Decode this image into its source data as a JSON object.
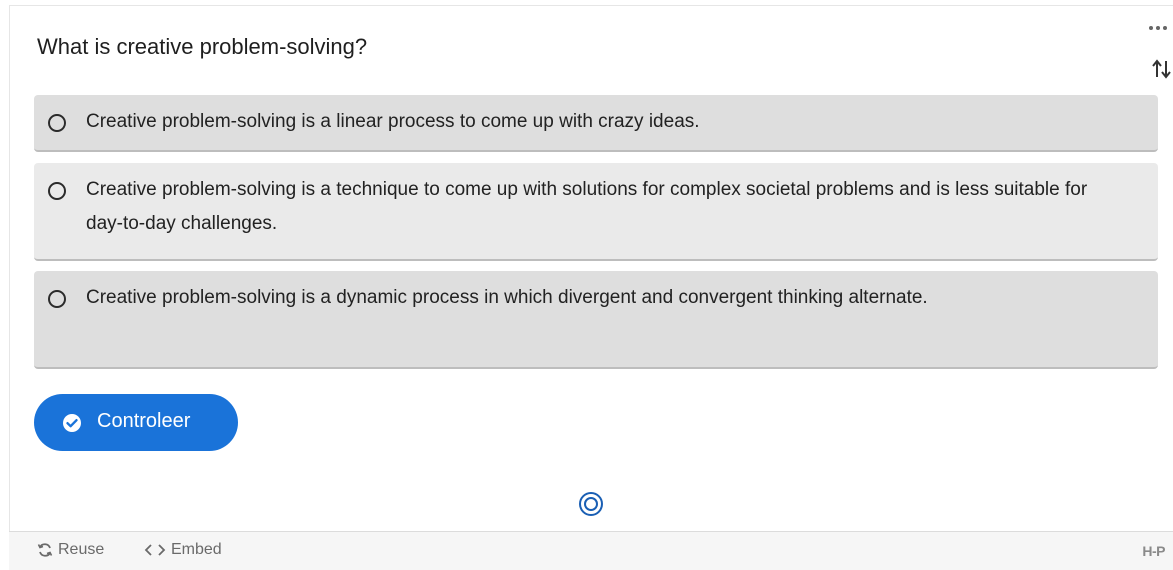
{
  "question": {
    "text": "What is creative problem-solving?"
  },
  "icons": {
    "more": "more-horizontal-icon",
    "sort": "sort-arrows-icon",
    "check": "check-circle-icon",
    "logo_mark": "h5p-circle-icon",
    "reuse": "reuse-icon",
    "embed": "embed-icon"
  },
  "options": [
    {
      "label": "Creative problem-solving is a linear process to come up with crazy ideas."
    },
    {
      "label": "Creative problem-solving is a technique to come up with solutions for complex societal problems and is less suitable for day-to-day challenges."
    },
    {
      "label": "Creative problem-solving is a dynamic process in which divergent and convergent thinking alternate."
    }
  ],
  "check_button": {
    "label": "Controleer"
  },
  "footer": {
    "reuse_label": "Reuse",
    "embed_label": "Embed",
    "brand": "H-P"
  },
  "colors": {
    "accent": "#1a73d9",
    "option_dark": "#dedede",
    "option_light": "#eaeaea"
  }
}
